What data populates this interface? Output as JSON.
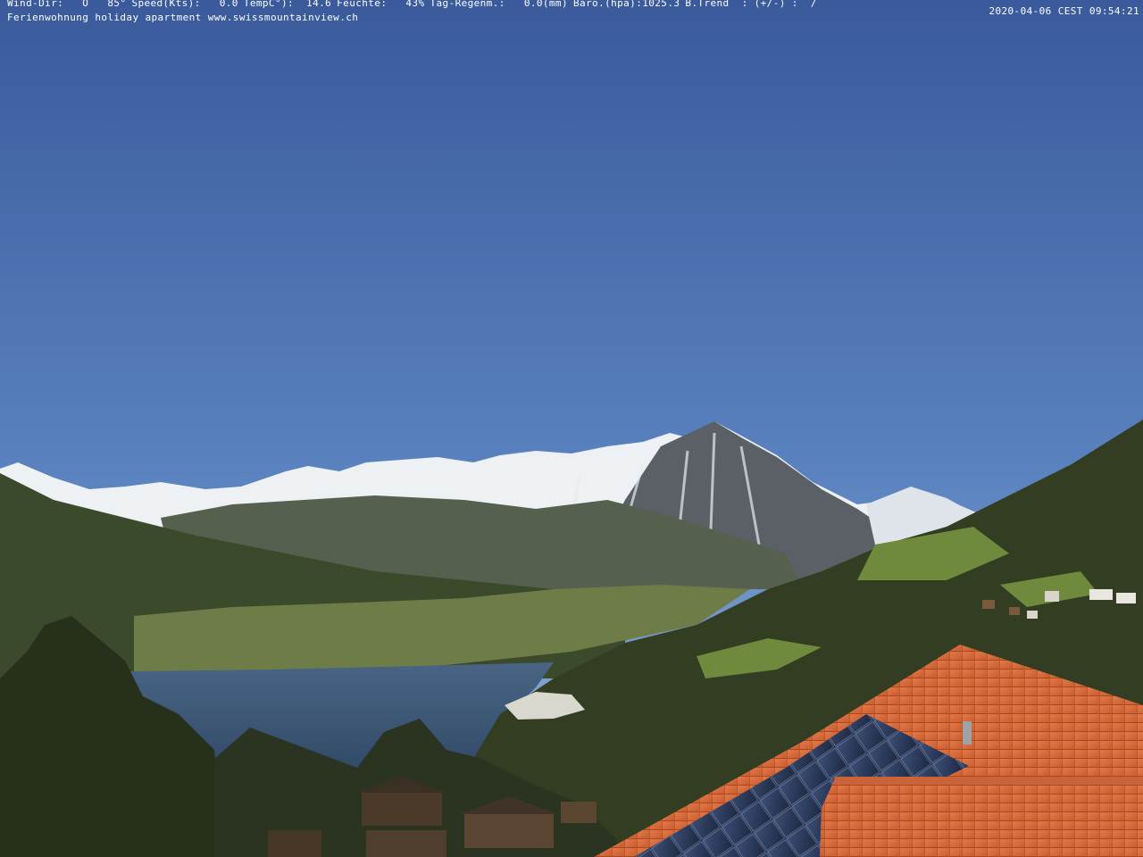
{
  "overlay": {
    "weather": {
      "wind_dir": "Wind-Dir:   O   85°",
      "speed": "Speed(Kts):   0.0",
      "temp": "TempC°):  14.6",
      "humidity": "Feuchte:   43%",
      "rain": "Tag-Regenm.:   0.0(mm)",
      "baro": "Baro.(hpa):1025.3",
      "trend": "B.Trend  : (+/-) :  /"
    },
    "timestamp": "2020-04-06 CEST 09:54:21",
    "caption": "Ferienwohnung holiday apartment www.swissmountainview.ch"
  },
  "scene": {
    "sky_top": "#3b5b9c",
    "sky_bottom": "#8fb0d6",
    "snow": "#f2f4f6",
    "rock": "#5a5f62",
    "lake": "#36506f",
    "forest": "#2f3a1f",
    "roof": "#d96b3c",
    "solar": "#2b3a5c"
  }
}
